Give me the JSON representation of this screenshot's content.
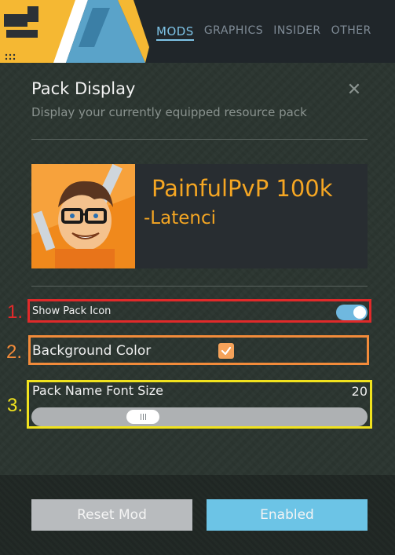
{
  "nav": {
    "tabs": [
      {
        "label": "MODS",
        "active": true
      },
      {
        "label": "GRAPHICS",
        "active": false
      },
      {
        "label": "INSIDER",
        "active": false
      },
      {
        "label": "OTHER",
        "active": false
      }
    ]
  },
  "panel": {
    "title": "Pack Display",
    "subtitle": "Display your currently equipped resource pack",
    "close_icon": "close-icon"
  },
  "preview": {
    "pack_name": "PainfulPvP 100k",
    "author": "-Latenci",
    "icon": "pack-avatar-image"
  },
  "settings": [
    {
      "number": "1.",
      "label": "Show Pack Icon",
      "control": "toggle",
      "value": true,
      "highlight_color": "#e02a2a"
    },
    {
      "number": "2.",
      "label": "Background Color",
      "control": "checkbox",
      "value": true,
      "highlight_color": "#f28b3a"
    },
    {
      "number": "3.",
      "label": "Pack Name Font Size",
      "control": "slider",
      "value": "20",
      "highlight_color": "#f0e21e"
    }
  ],
  "buttons": {
    "reset": "Reset Mod",
    "enabled": "Enabled"
  },
  "colors": {
    "accent": "#6cc4e6",
    "pack_name": "#f5a623",
    "checkbox": "#f5a25a"
  }
}
